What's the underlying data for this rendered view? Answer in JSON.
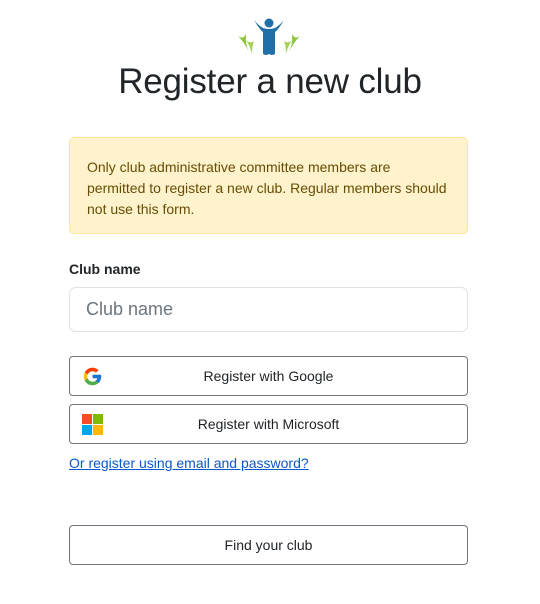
{
  "page": {
    "title": "Register a new club"
  },
  "alert": {
    "message": "Only club administrative committee members are permitted to register a new club. Regular members should not use this form."
  },
  "form": {
    "club_name_label": "Club name",
    "club_name_value": "",
    "club_name_placeholder": "Club name"
  },
  "buttons": {
    "google_label": "Register with Google",
    "microsoft_label": "Register with Microsoft",
    "find_club_label": "Find your club"
  },
  "links": {
    "email_password": "Or register using email and password?"
  },
  "icons": {
    "logo": "club-logo-icon",
    "google": "google-icon",
    "microsoft": "microsoft-icon"
  },
  "colors": {
    "alert_background": "#fff3cd",
    "alert_text": "#664d03",
    "link": "#0a58ca",
    "logo_blue": "#1f6fa8",
    "logo_green": "#8cc63f"
  }
}
